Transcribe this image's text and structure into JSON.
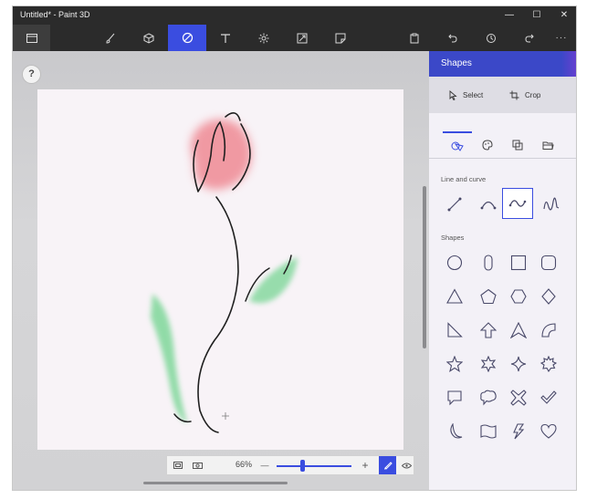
{
  "window": {
    "title": "Untitled* - Paint 3D",
    "controls": [
      "—",
      "☐",
      "✕"
    ]
  },
  "toolbar": {
    "menu_icon": "menu-icon",
    "tools": [
      {
        "name": "brushes",
        "icon": "brush-icon",
        "active": false
      },
      {
        "name": "3d-shapes",
        "icon": "cube-icon",
        "active": false
      },
      {
        "name": "2d-shapes",
        "icon": "2d-shapes-icon",
        "active": true
      },
      {
        "name": "text",
        "icon": "text-icon",
        "active": false
      },
      {
        "name": "effects",
        "icon": "sparkle-icon",
        "active": false
      },
      {
        "name": "canvas",
        "icon": "canvas-resize-icon",
        "active": false
      },
      {
        "name": "stickers",
        "icon": "sticker-icon",
        "active": false
      }
    ],
    "right_tools": [
      {
        "name": "paste",
        "icon": "paste-icon"
      },
      {
        "name": "undo",
        "icon": "undo-icon"
      },
      {
        "name": "history",
        "icon": "history-icon"
      },
      {
        "name": "redo",
        "icon": "redo-icon"
      },
      {
        "name": "more",
        "icon": "more-icon",
        "label": "···"
      }
    ]
  },
  "workspace": {
    "help_label": "?",
    "zoom": {
      "percent": "66%",
      "minus": "—",
      "plus": "+",
      "level": 0.35
    }
  },
  "panel": {
    "title": "Shapes",
    "select_label": "Select",
    "crop_label": "Crop",
    "category_tabs": [
      "shapes-icon",
      "palette-icon",
      "copy-icon",
      "folder-icon"
    ],
    "line_section": "Line and curve",
    "line_tools": [
      "line-icon",
      "arc-icon",
      "curve-icon",
      "multi-curve-icon"
    ],
    "selected_line_tool": "curve-icon",
    "shapes_section": "Shapes",
    "shapes": [
      "circle-icon",
      "rounded-rect-vertical-icon",
      "square-icon",
      "rounded-square-icon",
      "triangle-icon",
      "pentagon-icon",
      "hexagon-icon",
      "diamond-icon",
      "right-triangle-icon",
      "arrow-up-icon",
      "arrowhead-icon",
      "quarter-circle-icon",
      "star-5-icon",
      "star-6-icon",
      "star-4-icon",
      "starburst-icon",
      "speech-bubble-icon",
      "thought-bubble-icon",
      "x-mark-icon",
      "checkmark-icon",
      "moon-icon",
      "banner-icon",
      "lightning-icon",
      "heart-icon"
    ]
  },
  "colors": {
    "accent": "#3a4de0",
    "tulip": "#ee7b86",
    "leaf": "#7fd79a",
    "stroke": "#1f1f1f"
  }
}
